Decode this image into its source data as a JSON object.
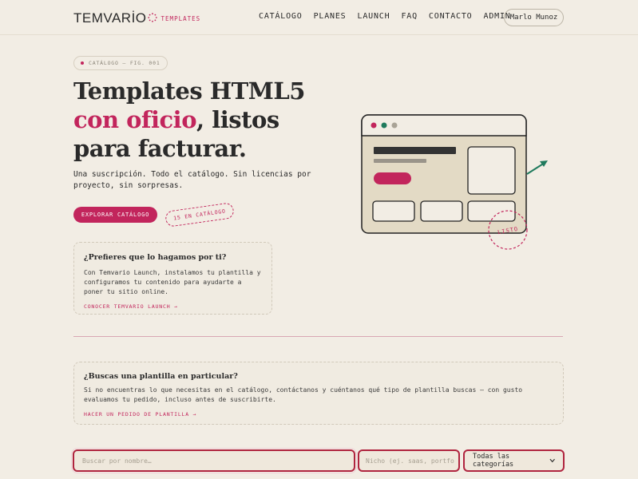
{
  "header": {
    "brand_name": "TEMVARİO",
    "brand_tag": "TEMPLATES",
    "nav": [
      "CATÁLOGO",
      "PLANES",
      "LAUNCH",
      "FAQ",
      "CONTACTO",
      "ADMIN"
    ],
    "user": "Marlo Munoz"
  },
  "hero": {
    "badge": "CATÁLOGO — FIG. 001",
    "title_line1": "Templates HTML5",
    "title_accent": "con oficio",
    "title_line2_rest": ", listos",
    "title_line3": "para facturar.",
    "subtitle": "Una suscripción. Todo el catálogo. Sin licencias por proyecto, sin sorpresas.",
    "cta_label": "EXPLORAR CATÁLOGO",
    "count_label": "15 EN CATÁLOGO",
    "illustration_stamp": "LISTO"
  },
  "launch_card": {
    "title": "¿Prefieres que lo hagamos por ti?",
    "text": "Con Temvario Launch, instalamos tu plantilla y configuramos tu contenido para ayudarte a poner tu sitio online.",
    "link": "CONOCER TEMVARIO LAUNCH →"
  },
  "request_card": {
    "title": "¿Buscas una plantilla en particular?",
    "text": "Si no encuentras lo que necesitas en el catálogo, contáctanos y cuéntanos qué tipo de plantilla buscas — con gusto evaluamos tu pedido, incluso antes de suscribirte.",
    "link": "HACER UN PEDIDO DE PLANTILLA →"
  },
  "filters": {
    "search_placeholder": "Buscar por nombre…",
    "niche_placeholder": "Nicho (ej. saas, portfo",
    "category_selected": "Todas las categorías"
  },
  "colors": {
    "accent": "#c2255c",
    "background": "#f2ede4",
    "illustration_fill": "#e3dac5",
    "arrow": "#1f7a5c"
  }
}
